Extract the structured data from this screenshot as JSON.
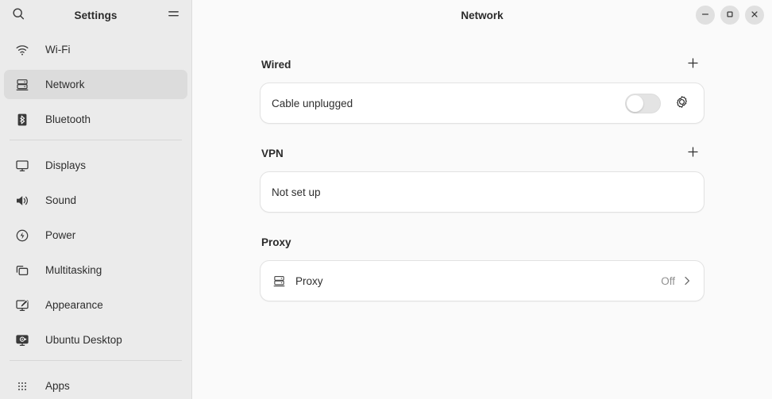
{
  "window": {
    "title": "Network",
    "controls": [
      {
        "name": "minimize",
        "glyph": "minimize-icon"
      },
      {
        "name": "maximize",
        "glyph": "maximize-icon"
      },
      {
        "name": "close",
        "glyph": "close-icon"
      }
    ]
  },
  "sidebar": {
    "title": "Settings",
    "search_icon": "search-icon",
    "menu_icon": "hamburger-menu-icon",
    "groups": [
      {
        "items": [
          {
            "label": "Wi-Fi",
            "icon": "wifi-icon",
            "selected": false
          },
          {
            "label": "Network",
            "icon": "network-icon",
            "selected": true
          },
          {
            "label": "Bluetooth",
            "icon": "bluetooth-icon",
            "selected": false
          }
        ]
      },
      {
        "items": [
          {
            "label": "Displays",
            "icon": "display-icon",
            "selected": false
          },
          {
            "label": "Sound",
            "icon": "sound-icon",
            "selected": false
          },
          {
            "label": "Power",
            "icon": "power-icon",
            "selected": false
          },
          {
            "label": "Multitasking",
            "icon": "multitasking-icon",
            "selected": false
          },
          {
            "label": "Appearance",
            "icon": "appearance-icon",
            "selected": false
          },
          {
            "label": "Ubuntu Desktop",
            "icon": "ubuntu-desktop-icon",
            "selected": false
          }
        ]
      },
      {
        "items": [
          {
            "label": "Apps",
            "icon": "apps-grid-icon",
            "selected": false
          }
        ]
      }
    ]
  },
  "main": {
    "sections": [
      {
        "title": "Wired",
        "add_button": "add-icon",
        "has_add": true,
        "rows": [
          {
            "label": "Cable unplugged",
            "type": "toggle",
            "toggle_on": false,
            "settings_icon": "gear-icon"
          }
        ]
      },
      {
        "title": "VPN",
        "add_button": "add-icon",
        "has_add": true,
        "rows": [
          {
            "label": "Not set up",
            "type": "text"
          }
        ]
      },
      {
        "title": "Proxy",
        "has_add": false,
        "rows": [
          {
            "label": "Proxy",
            "icon": "network-icon",
            "value": "Off",
            "type": "navigate",
            "chevron": "chevron-right-icon"
          }
        ]
      }
    ]
  },
  "colors": {
    "sidebar_bg": "#ebebeb",
    "main_bg": "#fafafa",
    "card_bg": "#ffffff",
    "selected_bg": "#dcdcdc",
    "accent": "#e95420",
    "muted_text": "#909090"
  }
}
